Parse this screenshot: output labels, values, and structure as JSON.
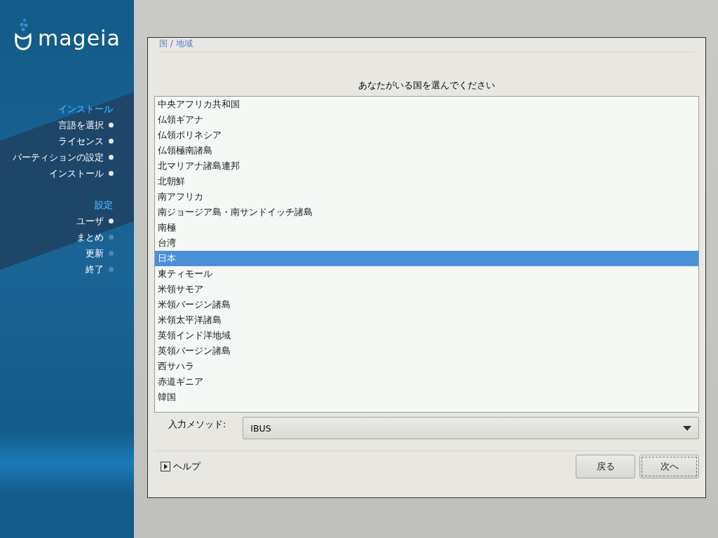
{
  "sidebar": {
    "logo": "mageia",
    "sections": [
      {
        "title": "インストール",
        "items": [
          {
            "label": "言語を選択",
            "done": true
          },
          {
            "label": "ライセンス",
            "done": true
          },
          {
            "label": "パーティションの設定",
            "done": true
          },
          {
            "label": "インストール",
            "done": true
          }
        ]
      },
      {
        "title": "設定",
        "items": [
          {
            "label": "ユーザ",
            "done": true
          },
          {
            "label": "まとめ",
            "done": false
          },
          {
            "label": "更新",
            "done": false
          },
          {
            "label": "終了",
            "done": false
          }
        ]
      }
    ]
  },
  "dialog": {
    "breadcrumb": "国 / 地域",
    "heading": "あなたがいる国を選んでください",
    "countries": [
      {
        "label": "中央アフリカ共和国",
        "selected": false
      },
      {
        "label": "仏領ギアナ",
        "selected": false
      },
      {
        "label": "仏領ポリネシア",
        "selected": false
      },
      {
        "label": "仏領極南諸島",
        "selected": false
      },
      {
        "label": "北マリアナ諸島連邦",
        "selected": false
      },
      {
        "label": "北朝鮮",
        "selected": false
      },
      {
        "label": "南アフリカ",
        "selected": false
      },
      {
        "label": "南ジョージア島・南サンドイッチ諸島",
        "selected": false
      },
      {
        "label": "南極",
        "selected": false
      },
      {
        "label": "台湾",
        "selected": false
      },
      {
        "label": "日本",
        "selected": true
      },
      {
        "label": "東ティモール",
        "selected": false
      },
      {
        "label": "米領サモア",
        "selected": false
      },
      {
        "label": "米領バージン諸島",
        "selected": false
      },
      {
        "label": "米領太平洋諸島",
        "selected": false
      },
      {
        "label": "英領インド洋地域",
        "selected": false
      },
      {
        "label": "英領バージン諸島",
        "selected": false
      },
      {
        "label": "西サハラ",
        "selected": false
      },
      {
        "label": "赤道ギニア",
        "selected": false
      },
      {
        "label": "韓国",
        "selected": false
      }
    ],
    "input_method": {
      "label": "入力メソッド:",
      "value": "IBUS"
    },
    "help": "ヘルプ",
    "buttons": [
      "戻る",
      "次へ"
    ]
  }
}
